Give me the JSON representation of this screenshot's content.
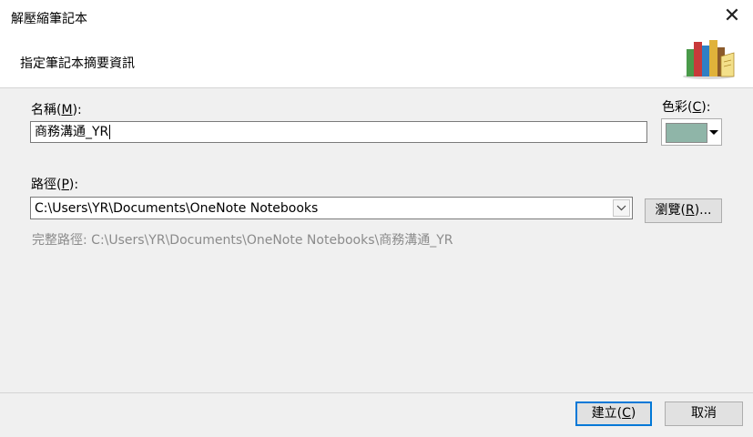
{
  "window": {
    "title": "解壓縮筆記本",
    "close_glyph": "✕"
  },
  "header": {
    "subtitle": "指定筆記本摘要資訊",
    "logo_icon": "books-icon"
  },
  "name": {
    "label_prefix": "名稱(",
    "label_key": "M",
    "label_suffix": "):",
    "value": "商務溝通_YR"
  },
  "color": {
    "label_prefix": "色彩(",
    "label_key": "C",
    "label_suffix": "):",
    "swatch": "#8fb5a8",
    "dropdown_icon": "triangle-down-icon"
  },
  "path": {
    "label_prefix": "路徑(",
    "label_key": "P",
    "label_suffix": "):",
    "value": "C:\\Users\\YR\\Documents\\OneNote Notebooks",
    "dropdown_icon": "chevron-down-icon"
  },
  "browse": {
    "label_prefix": "瀏覽(",
    "label_key": "R",
    "label_suffix": ")..."
  },
  "full_path": "完整路徑: C:\\Users\\YR\\Documents\\OneNote Notebooks\\商務溝通_YR",
  "buttons": {
    "create_prefix": "建立(",
    "create_key": "C",
    "create_suffix": ")",
    "cancel": "取消"
  },
  "colors": {
    "accent": "#0078d7",
    "background": "#f0f0f0",
    "header_bg": "#ffffff"
  }
}
